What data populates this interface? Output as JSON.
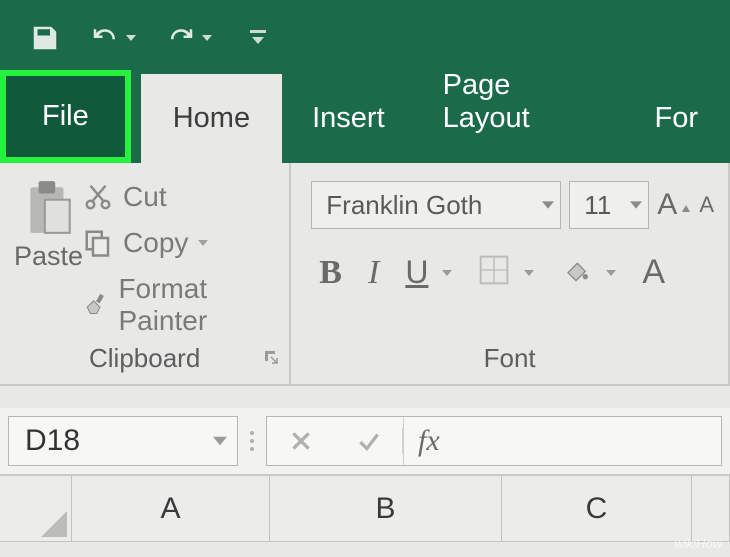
{
  "qat": {
    "save": "save-icon",
    "undo": "undo-icon",
    "redo": "redo-icon",
    "customize": "customize-icon"
  },
  "tabs": {
    "file": "File",
    "home": "Home",
    "insert": "Insert",
    "page_layout": "Page Layout",
    "formulas": "For"
  },
  "clipboard": {
    "paste": "Paste",
    "cut": "Cut",
    "copy": "Copy",
    "painter": "Format Painter",
    "group_label": "Clipboard"
  },
  "font": {
    "name": "Franklin Goth",
    "size": "11",
    "bold": "B",
    "italic": "I",
    "underline": "U",
    "font_letter": "A",
    "group_label": "Font"
  },
  "namebox": "D18",
  "fx_label": "fx",
  "columns": {
    "a": "A",
    "b": "B",
    "c": "C"
  },
  "watermark": "wikiHow"
}
